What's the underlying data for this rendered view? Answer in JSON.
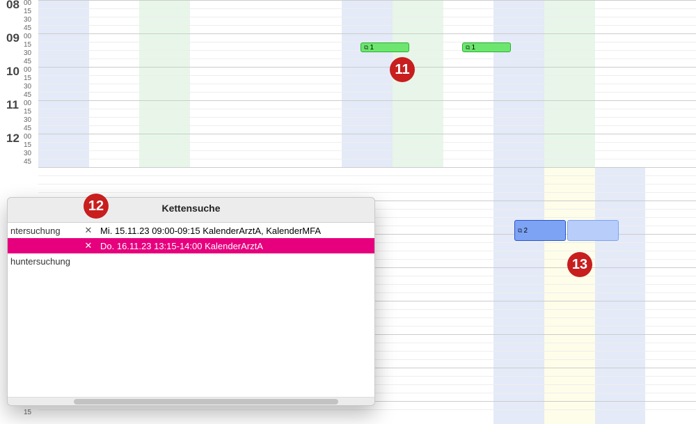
{
  "hours": [
    "08",
    "09",
    "10",
    "11",
    "12"
  ],
  "minutes": [
    "00",
    "15",
    "30",
    "45"
  ],
  "columns": [
    "col-blue",
    "col-plain",
    "col-green",
    "col-plain",
    "col-plain",
    "col-plain",
    "col-blue",
    "col-green",
    "col-plain",
    "col-blue",
    "col-green",
    "col-plain",
    "col-plain"
  ],
  "lower_columns": [
    "col-plain",
    "col-plain",
    "col-plain",
    "col-plain",
    "col-plain",
    "col-plain",
    "col-plain",
    "col-plain",
    "col-plain",
    "col-blue",
    "col-yellow",
    "col-blue",
    "col-plain"
  ],
  "events": {
    "green1": {
      "label": "1"
    },
    "green2": {
      "label": "1"
    },
    "blue": {
      "label": "2"
    }
  },
  "panel": {
    "title": "Kettensuche",
    "rows": [
      {
        "partial": "ntersuchung",
        "x": "✕",
        "text": "Mi.  15.11.23  09:00-09:15 KalenderArztA, KalenderMFA",
        "hl": false
      },
      {
        "partial": "",
        "x": "✕",
        "text": "Do.  16.11.23  13:15-14:00 KalenderArztA",
        "hl": true
      },
      {
        "partial": "huntersuchung",
        "x": "",
        "text": "",
        "hl": false
      }
    ]
  },
  "callouts": {
    "c11": "11",
    "c12": "12",
    "c13": "13"
  }
}
